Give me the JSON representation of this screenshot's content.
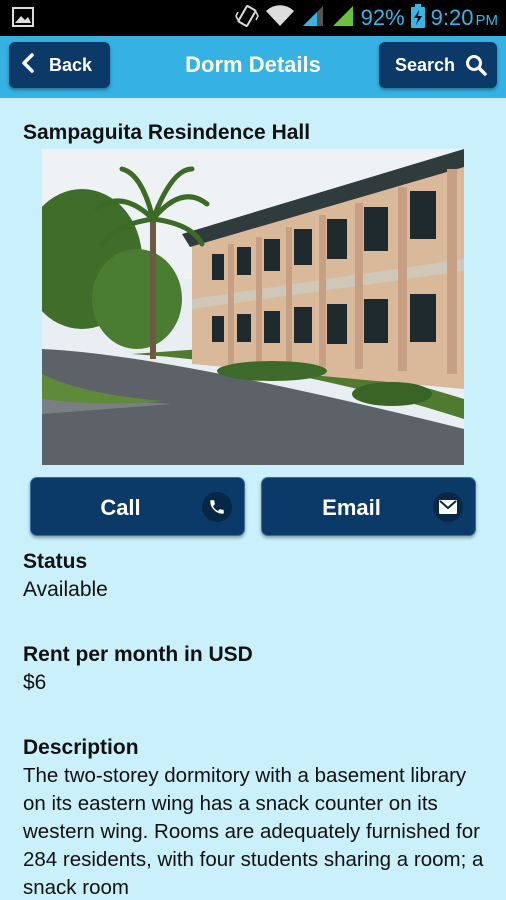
{
  "status_bar": {
    "battery_percent": "92%",
    "time": "9:20",
    "ampm": "PM",
    "icons": [
      "gallery-icon",
      "vibrate-icon",
      "wifi-icon",
      "signal-icon",
      "signal-icon",
      "battery-charging-icon"
    ]
  },
  "header": {
    "back_label": "Back",
    "title": "Dorm Details",
    "search_label": "Search"
  },
  "dorm": {
    "name": "Sampaguita Resindence Hall",
    "actions": {
      "call_label": "Call",
      "email_label": "Email"
    },
    "status_heading": "Status",
    "status_value": "Available",
    "rent_heading": "Rent per month in USD",
    "rent_value": "$6",
    "description_heading": "Description",
    "description_text": "The two-storey dormitory with a basement library on its eastern wing has a snack counter on its western wing. Rooms are adequately furnished for 284 residents, with four students sharing a room; a snack room"
  },
  "colors": {
    "background": "#c9f0fb",
    "topbar": "#35b1e3",
    "button": "#0c3a68",
    "status_text": "#35b6e6"
  }
}
